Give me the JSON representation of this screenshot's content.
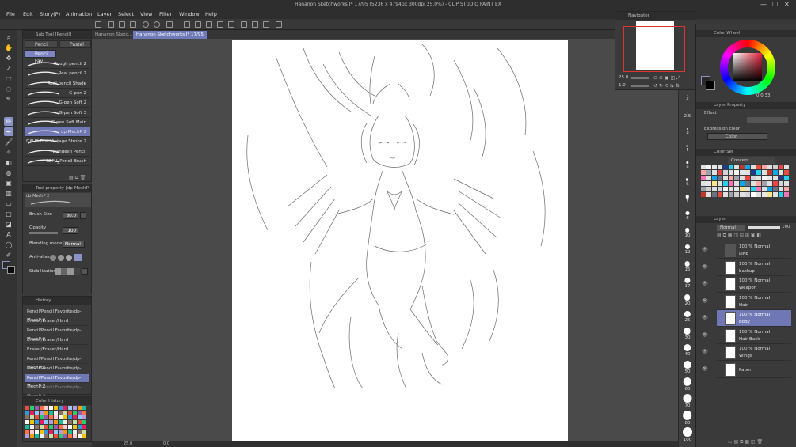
{
  "window": {
    "title": "Hananon Sketchworks I* 17/95 (5236 x 4794px 300dpi 25.0%) - CLIP STUDIO PAINT EX",
    "minimize": "—",
    "maximize": "☐",
    "close": "✕"
  },
  "menu": [
    "File",
    "Edit",
    "Story(P)",
    "Animation",
    "Layer",
    "Select",
    "View",
    "Filter",
    "Window",
    "Help"
  ],
  "document_tabs": [
    "Hananon Sketc…",
    "Hananon Sketchworks I* 17/95"
  ],
  "sub_tool": {
    "panel_title": "Sub Tool [Pencil]",
    "tabs": [
      "Pencil",
      "Pastel"
    ],
    "group": "Pencil Fav",
    "brushes": [
      "Rough pencil 2",
      "Real pencil 2",
      "Real pencil Shade",
      "G-pen 2",
      "G-pen Soft 2",
      "G-pen Soft 3",
      "G-pen Soft Main",
      "dp-MechP 2",
      "DAUB Fine Vintage Stroke 2",
      "Dandelin Pencil",
      "LEFU_Pencil Brush"
    ],
    "selected_brush_index": 7
  },
  "tool_property": {
    "panel_title": "Tool property [dp-MechP 2]",
    "preview_label": "dp-MechP 2",
    "brush_size_label": "Brush Size",
    "brush_size_value": "80.0",
    "opacity_label": "Opacity",
    "opacity_value": "100",
    "blending_label": "Blending mode",
    "blending_value": "Normal",
    "antialias_label": "Anti-alias",
    "stabilization_label": "Stabilization"
  },
  "history": {
    "panel_title": "History",
    "items": [
      "Pencil/Pencil Favorite/dp-MechP 2",
      "Eraser/Eraser/Hard",
      "Pencil/Pencil Favorite/dp-MechP 2",
      "Eraser/Eraser/Hard",
      "Eraser/Eraser/Hard",
      "Pencil/Pencil Favorite/dp-MechP 2",
      "Pencil/Pencil Favorite/dp-MechP 2",
      "Pencil/Pencil Favorite/dp-MechP 2",
      "Pencil/Pencil Favorite/dp-MechP 2"
    ],
    "selected_index": 7
  },
  "color_history": {
    "panel_title": "Color History"
  },
  "navigator": {
    "panel_title": "Navigator",
    "zoom": "25.0",
    "rotation": "1.0"
  },
  "color_wheel": {
    "panel_title": "Color Wheel",
    "values": "0  0  33"
  },
  "layer_property": {
    "panel_title": "Layer Property",
    "effect_label": "Effect",
    "expression_label": "Expression color",
    "expression_value": "Color"
  },
  "color_set": {
    "panel_title": "Color Set",
    "set_name": "Concept"
  },
  "layer_panel": {
    "panel_title": "Layer",
    "blend_mode": "Normal",
    "opacity": "100",
    "layers": [
      {
        "line1": "100 % Normal",
        "line2": "LINE"
      },
      {
        "line1": "100 % Normal",
        "line2": "backup"
      },
      {
        "line1": "100 % Normal",
        "line2": "Weapon"
      },
      {
        "line1": "100 % Normal",
        "line2": "Hair"
      },
      {
        "line1": "100 % Normal",
        "line2": "Body"
      },
      {
        "line1": "100 % Normal",
        "line2": "Hair Back"
      },
      {
        "line1": "100 % Normal",
        "line2": "Wings"
      },
      {
        "line1": "",
        "line2": "Paper"
      }
    ],
    "selected_index": 4
  },
  "brush_size_ruler": [
    "2",
    "2.5",
    "3",
    "4",
    "5",
    "6",
    "7",
    "8",
    "10",
    "12",
    "15",
    "17",
    "20",
    "25",
    "30",
    "40",
    "50",
    "60",
    "70",
    "80",
    "100"
  ],
  "status": {
    "zoom": "25.0",
    "coord": "0.0"
  },
  "colors": {
    "accent": "#6f78b4",
    "panel": "#3a3a3a",
    "paper": "#ffffff"
  }
}
